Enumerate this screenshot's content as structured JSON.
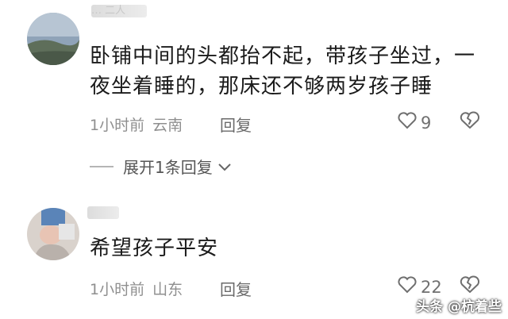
{
  "comments": [
    {
      "username": "… 二人",
      "text_line1": "卧铺中间的头都抬不起，带孩子坐过，一",
      "text_line2": "夜坐着睡的，那床还不够两岁孩子睡",
      "time": "1小时前",
      "location": "云南",
      "reply_label": "回复",
      "likes": "9",
      "expand_label": "展开1条回复"
    },
    {
      "username": "",
      "text_line1": "希望孩子平安",
      "time": "1小时前",
      "location": "山东",
      "reply_label": "回复",
      "likes": "22"
    }
  ],
  "watermark": "头条 @杭着些",
  "icons": {
    "like": "heart-outline-icon",
    "dislike": "broken-heart-icon",
    "expand": "chevron-down-icon"
  },
  "colors": {
    "text": "#1b1b1b",
    "meta": "#8f8f8f",
    "reply": "#6a6a6a"
  }
}
